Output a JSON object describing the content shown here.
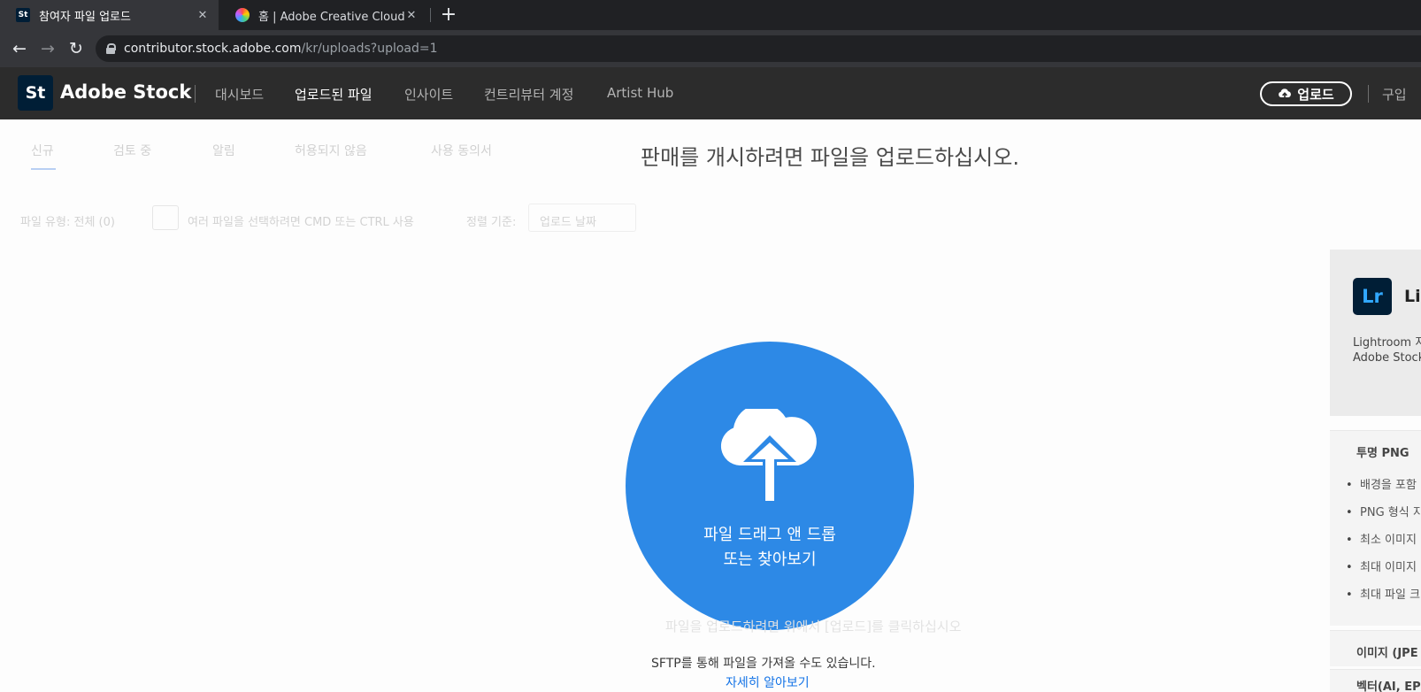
{
  "browser": {
    "tabs": [
      {
        "title": "참여자 파일 업로드",
        "favicon": "adobe-stock-favicon",
        "active": true
      },
      {
        "title": "홈 | Adobe Creative Cloud",
        "favicon": "creative-cloud-favicon",
        "active": false
      }
    ],
    "new_tab": "+",
    "address": {
      "host": "contributor.stock.adobe.com",
      "path": "/kr/uploads?upload=1"
    }
  },
  "header": {
    "logo_text": "St",
    "brand": "Adobe Stock",
    "nav": [
      "대시보드",
      "업로드된 파일",
      "인사이트",
      "컨트리뷰터 계정",
      "Artist Hub"
    ],
    "active_nav": "업로드된 파일",
    "upload_button": "업로드",
    "buy": "구입"
  },
  "subtabs": [
    "신규",
    "검토 중",
    "알림",
    "허용되지 않음",
    "사용 동의서"
  ],
  "filters": {
    "file_type": "파일 유형: 전체 (0)",
    "multi_select_hint": "여러 파일을 선택하려면 CMD 또는 CTRL 사용",
    "sort_label": "정렬 기준:",
    "sort_value": "업로드 날짜"
  },
  "main": {
    "headline": "판매를 개시하려면 파일을 업로드하십시오.",
    "drop_line1": "파일 드래그 앤 드롭",
    "drop_line2": "또는 찾아보기",
    "faded_hint": "파일을 업로드하려면 위에서 [업로드]를 클릭하십시오",
    "sftp_text": "SFTP를 통해 파일을 가져올 수도 있습니다.",
    "learn_more": "자세히 알아보기"
  },
  "side_panel": {
    "lr_badge": "Lr",
    "lr_title": "Lig",
    "text_line1": "Lightroom 지",
    "text_line2": "Adobe Stock",
    "png_header": "투명 PNG",
    "png_bullets": [
      "배경을 포함",
      "PNG 형식 지",
      "최소 이미지",
      "최대 이미지",
      "최대 파일 크"
    ],
    "image_header": "이미지 (JPE",
    "vector_header": "벡터(AI, EPS"
  },
  "colors": {
    "accent": "#2d89e6",
    "header_bg": "#2c2c2c",
    "link": "#1473e6"
  }
}
